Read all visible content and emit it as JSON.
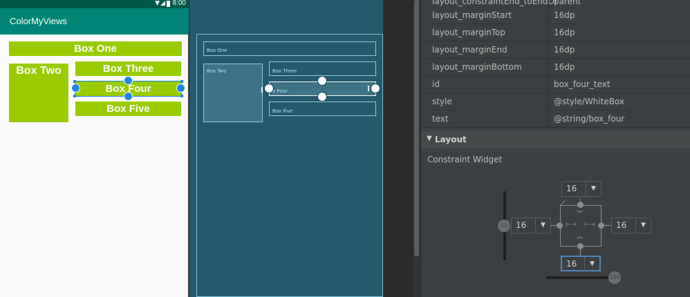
{
  "status_bar": {
    "time": "8:00"
  },
  "app": {
    "title": "ColorMyViews"
  },
  "design_boxes": {
    "one": "Box One",
    "two": "Box Two",
    "three": "Box Three",
    "four": "Box Four",
    "five": "Box Five"
  },
  "blueprint_boxes": {
    "one": "Box One",
    "two": "Box Two",
    "three": "Box Three",
    "four": "x Four",
    "five": "Box Five"
  },
  "attributes": [
    {
      "name": "layout_constraintEnd_toEndOf",
      "value": "parent"
    },
    {
      "name": "layout_marginStart",
      "value": "16dp"
    },
    {
      "name": "layout_marginTop",
      "value": "16dp"
    },
    {
      "name": "layout_marginEnd",
      "value": "16dp"
    },
    {
      "name": "layout_marginBottom",
      "value": "16dp"
    },
    {
      "name": "id",
      "value": "box_four_text"
    },
    {
      "name": "style",
      "value": "@style/WhiteBox"
    },
    {
      "name": "text",
      "value": "@string/box_four"
    }
  ],
  "layout_section": {
    "title": "Layout",
    "subtitle": "Constraint Widget",
    "margins": {
      "top": "16",
      "left": "16",
      "right": "16",
      "bottom": "16"
    },
    "vertical_bias": "50",
    "horizontal_bias": "100"
  },
  "colors": {
    "primary": "#008577",
    "primary_dark": "#00574b",
    "box": "#99cc00",
    "selection": "#1e88e5",
    "blueprint": "#245a6e"
  }
}
